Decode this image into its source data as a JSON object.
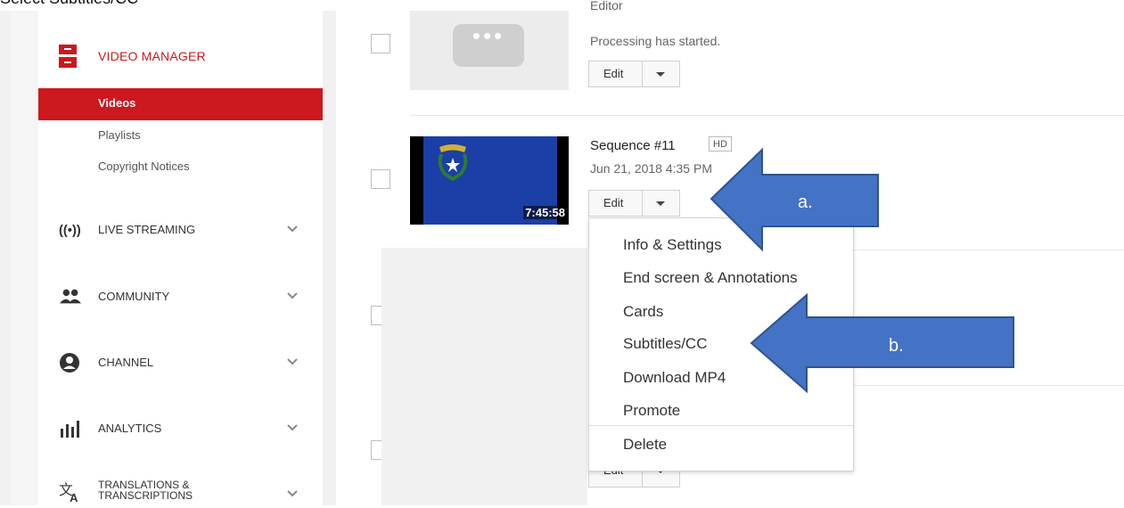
{
  "caption": "Select Subtitles/CC",
  "sidebar": {
    "video_manager_label": "VIDEO MANAGER",
    "sub_items": [
      {
        "label": "Videos",
        "active": true
      },
      {
        "label": "Playlists",
        "active": false
      },
      {
        "label": "Copyright Notices",
        "active": false
      }
    ],
    "sections": [
      {
        "label": "LIVE STREAMING",
        "icon": "live-streaming-icon"
      },
      {
        "label": "COMMUNITY",
        "icon": "community-icon"
      },
      {
        "label": "CHANNEL",
        "icon": "channel-icon"
      },
      {
        "label": "ANALYTICS",
        "icon": "analytics-icon"
      },
      {
        "label": "TRANSLATIONS & TRANSCRIPTIONS",
        "label_line1": "TRANSLATIONS &",
        "label_line2": "TRANSCRIPTIONS",
        "icon": "translate-icon"
      }
    ],
    "accent_color": "#cc181e"
  },
  "videos": [
    {
      "title_partial": "Editor",
      "status": "Processing has started.",
      "edit_label": "Edit"
    },
    {
      "title": "Sequence #11",
      "badge": "HD",
      "date": "Jun 21, 2018 4:35 PM",
      "duration": "7:45:58",
      "edit_label": "Edit"
    },
    {
      "edit_label": "Edit"
    }
  ],
  "menu": {
    "items": [
      "Info & Settings",
      "End screen & Annotations",
      "Cards",
      "Subtitles/CC",
      "Download MP4",
      "Promote",
      "Delete"
    ]
  },
  "annotations": {
    "arrow_a_label": "a.",
    "arrow_b_label": "b.",
    "arrow_color": "#4472c4"
  }
}
